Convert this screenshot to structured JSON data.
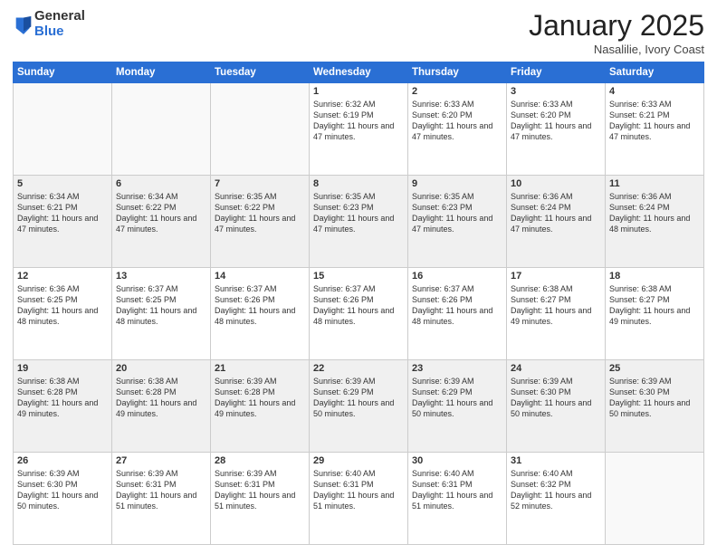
{
  "logo": {
    "general": "General",
    "blue": "Blue"
  },
  "header": {
    "month": "January 2025",
    "location": "Nasalilie, Ivory Coast"
  },
  "weekdays": [
    "Sunday",
    "Monday",
    "Tuesday",
    "Wednesday",
    "Thursday",
    "Friday",
    "Saturday"
  ],
  "weeks": [
    [
      {
        "day": "",
        "info": ""
      },
      {
        "day": "",
        "info": ""
      },
      {
        "day": "",
        "info": ""
      },
      {
        "day": "1",
        "info": "Sunrise: 6:32 AM\nSunset: 6:19 PM\nDaylight: 11 hours and 47 minutes."
      },
      {
        "day": "2",
        "info": "Sunrise: 6:33 AM\nSunset: 6:20 PM\nDaylight: 11 hours and 47 minutes."
      },
      {
        "day": "3",
        "info": "Sunrise: 6:33 AM\nSunset: 6:20 PM\nDaylight: 11 hours and 47 minutes."
      },
      {
        "day": "4",
        "info": "Sunrise: 6:33 AM\nSunset: 6:21 PM\nDaylight: 11 hours and 47 minutes."
      }
    ],
    [
      {
        "day": "5",
        "info": "Sunrise: 6:34 AM\nSunset: 6:21 PM\nDaylight: 11 hours and 47 minutes."
      },
      {
        "day": "6",
        "info": "Sunrise: 6:34 AM\nSunset: 6:22 PM\nDaylight: 11 hours and 47 minutes."
      },
      {
        "day": "7",
        "info": "Sunrise: 6:35 AM\nSunset: 6:22 PM\nDaylight: 11 hours and 47 minutes."
      },
      {
        "day": "8",
        "info": "Sunrise: 6:35 AM\nSunset: 6:23 PM\nDaylight: 11 hours and 47 minutes."
      },
      {
        "day": "9",
        "info": "Sunrise: 6:35 AM\nSunset: 6:23 PM\nDaylight: 11 hours and 47 minutes."
      },
      {
        "day": "10",
        "info": "Sunrise: 6:36 AM\nSunset: 6:24 PM\nDaylight: 11 hours and 47 minutes."
      },
      {
        "day": "11",
        "info": "Sunrise: 6:36 AM\nSunset: 6:24 PM\nDaylight: 11 hours and 48 minutes."
      }
    ],
    [
      {
        "day": "12",
        "info": "Sunrise: 6:36 AM\nSunset: 6:25 PM\nDaylight: 11 hours and 48 minutes."
      },
      {
        "day": "13",
        "info": "Sunrise: 6:37 AM\nSunset: 6:25 PM\nDaylight: 11 hours and 48 minutes."
      },
      {
        "day": "14",
        "info": "Sunrise: 6:37 AM\nSunset: 6:26 PM\nDaylight: 11 hours and 48 minutes."
      },
      {
        "day": "15",
        "info": "Sunrise: 6:37 AM\nSunset: 6:26 PM\nDaylight: 11 hours and 48 minutes."
      },
      {
        "day": "16",
        "info": "Sunrise: 6:37 AM\nSunset: 6:26 PM\nDaylight: 11 hours and 48 minutes."
      },
      {
        "day": "17",
        "info": "Sunrise: 6:38 AM\nSunset: 6:27 PM\nDaylight: 11 hours and 49 minutes."
      },
      {
        "day": "18",
        "info": "Sunrise: 6:38 AM\nSunset: 6:27 PM\nDaylight: 11 hours and 49 minutes."
      }
    ],
    [
      {
        "day": "19",
        "info": "Sunrise: 6:38 AM\nSunset: 6:28 PM\nDaylight: 11 hours and 49 minutes."
      },
      {
        "day": "20",
        "info": "Sunrise: 6:38 AM\nSunset: 6:28 PM\nDaylight: 11 hours and 49 minutes."
      },
      {
        "day": "21",
        "info": "Sunrise: 6:39 AM\nSunset: 6:28 PM\nDaylight: 11 hours and 49 minutes."
      },
      {
        "day": "22",
        "info": "Sunrise: 6:39 AM\nSunset: 6:29 PM\nDaylight: 11 hours and 50 minutes."
      },
      {
        "day": "23",
        "info": "Sunrise: 6:39 AM\nSunset: 6:29 PM\nDaylight: 11 hours and 50 minutes."
      },
      {
        "day": "24",
        "info": "Sunrise: 6:39 AM\nSunset: 6:30 PM\nDaylight: 11 hours and 50 minutes."
      },
      {
        "day": "25",
        "info": "Sunrise: 6:39 AM\nSunset: 6:30 PM\nDaylight: 11 hours and 50 minutes."
      }
    ],
    [
      {
        "day": "26",
        "info": "Sunrise: 6:39 AM\nSunset: 6:30 PM\nDaylight: 11 hours and 50 minutes."
      },
      {
        "day": "27",
        "info": "Sunrise: 6:39 AM\nSunset: 6:31 PM\nDaylight: 11 hours and 51 minutes."
      },
      {
        "day": "28",
        "info": "Sunrise: 6:39 AM\nSunset: 6:31 PM\nDaylight: 11 hours and 51 minutes."
      },
      {
        "day": "29",
        "info": "Sunrise: 6:40 AM\nSunset: 6:31 PM\nDaylight: 11 hours and 51 minutes."
      },
      {
        "day": "30",
        "info": "Sunrise: 6:40 AM\nSunset: 6:31 PM\nDaylight: 11 hours and 51 minutes."
      },
      {
        "day": "31",
        "info": "Sunrise: 6:40 AM\nSunset: 6:32 PM\nDaylight: 11 hours and 52 minutes."
      },
      {
        "day": "",
        "info": ""
      }
    ]
  ]
}
